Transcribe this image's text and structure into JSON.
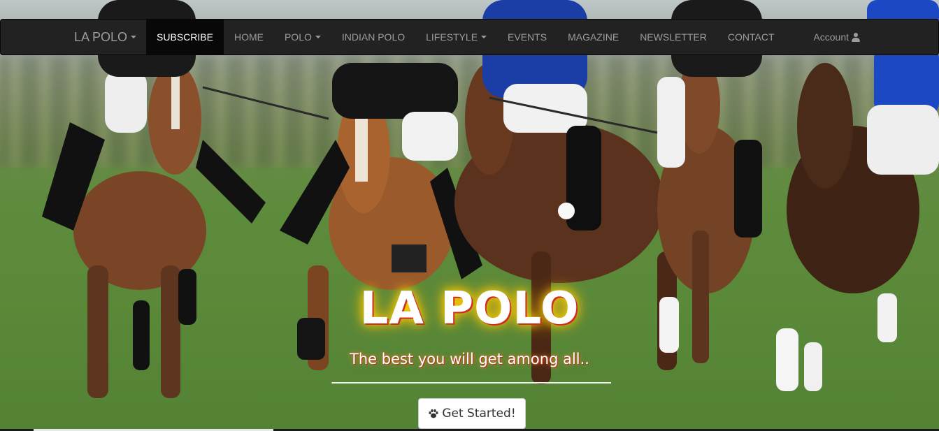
{
  "navbar": {
    "brand": "LA POLO",
    "items": [
      {
        "label": "SUBSCRIBE",
        "active": true,
        "dropdown": false
      },
      {
        "label": "HOME",
        "active": false,
        "dropdown": false
      },
      {
        "label": "POLO",
        "active": false,
        "dropdown": true
      },
      {
        "label": "INDIAN POLO",
        "active": false,
        "dropdown": false
      },
      {
        "label": "LIFESTYLE",
        "active": false,
        "dropdown": true
      },
      {
        "label": "EVENTS",
        "active": false,
        "dropdown": false
      },
      {
        "label": "MAGAZINE",
        "active": false,
        "dropdown": false
      },
      {
        "label": "NEWSLETTER",
        "active": false,
        "dropdown": false
      },
      {
        "label": "CONTACT",
        "active": false,
        "dropdown": false
      }
    ],
    "account_label": "Account",
    "account_icon": "user-icon"
  },
  "hero": {
    "title": "LA POLO",
    "subtitle": "The best you will get among all..",
    "cta_label": "Get Started!",
    "cta_icon": "paw-icon",
    "background": "polo players on horseback galloping across a grass field"
  },
  "colors": {
    "navbar_bg": "#222222",
    "nav_text": "#9d9d9d",
    "active_bg": "#080808",
    "title_shadow": "#d42a1e",
    "title_glow": "#ffd400"
  }
}
